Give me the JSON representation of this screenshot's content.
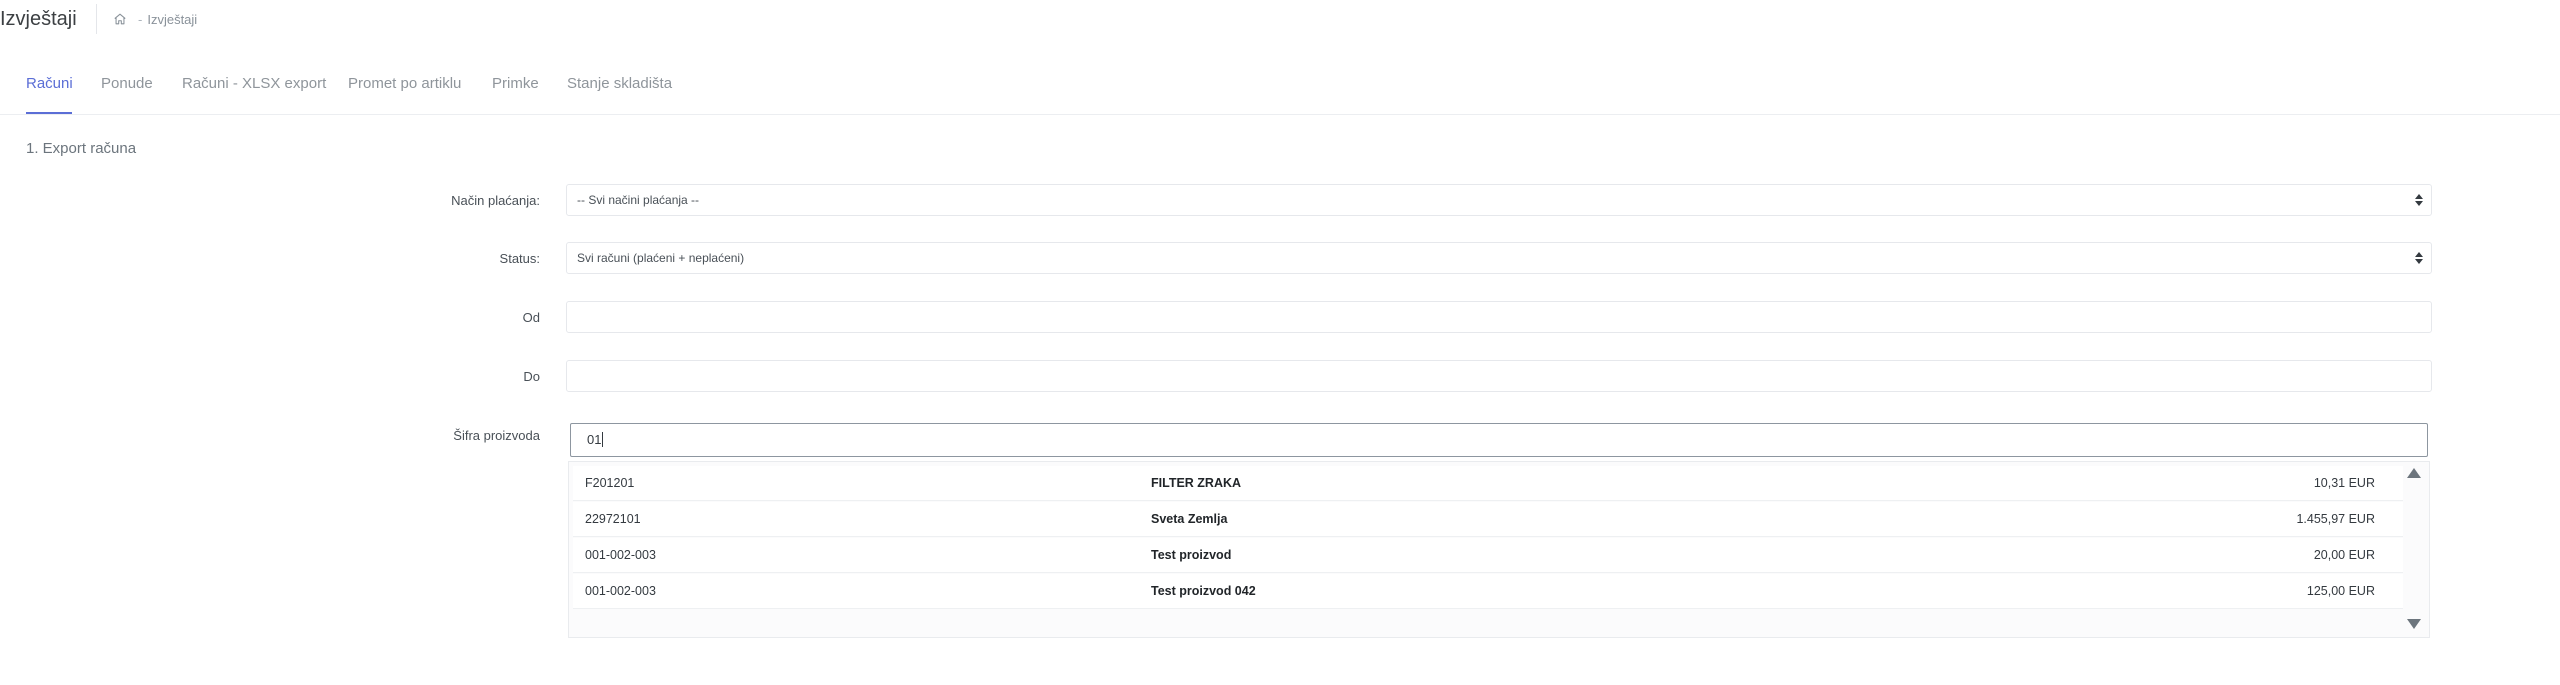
{
  "header": {
    "title": "Izvještaji",
    "breadcrumb": {
      "home_icon": "home-icon",
      "separator": "-",
      "current": "Izvještaji"
    }
  },
  "tabs": [
    {
      "label": "Računi",
      "active": true
    },
    {
      "label": "Ponude",
      "active": false
    },
    {
      "label": "Računi - XLSX export",
      "active": false
    },
    {
      "label": "Promet po artiklu",
      "active": false
    },
    {
      "label": "Primke",
      "active": false
    },
    {
      "label": "Stanje skladišta",
      "active": false
    }
  ],
  "section_title": "1. Export računa",
  "form": {
    "payment_method": {
      "label": "Način plaćanja:",
      "value": "-- Svi načini plaćanja --"
    },
    "status": {
      "label": "Status:",
      "value": "Svi računi (plaćeni + neplaćeni)"
    },
    "from": {
      "label": "Od",
      "value": ""
    },
    "to": {
      "label": "Do",
      "value": ""
    },
    "product_code": {
      "label": "Šifra proizvoda",
      "value": "01"
    }
  },
  "autocomplete": [
    {
      "code": "F201201",
      "name": "FILTER ZRAKA",
      "price": "10,31 EUR"
    },
    {
      "code": "22972101",
      "name": "Sveta Zemlja",
      "price": "1.455,97 EUR"
    },
    {
      "code": "001-002-003",
      "name": "Test proizvod",
      "price": "20,00 EUR"
    },
    {
      "code": "001-002-003",
      "name": "Test proizvod 042",
      "price": "125,00 EUR"
    }
  ],
  "colors": {
    "accent": "#5b6ed6",
    "text": "#343a40",
    "muted": "#8f959b"
  }
}
